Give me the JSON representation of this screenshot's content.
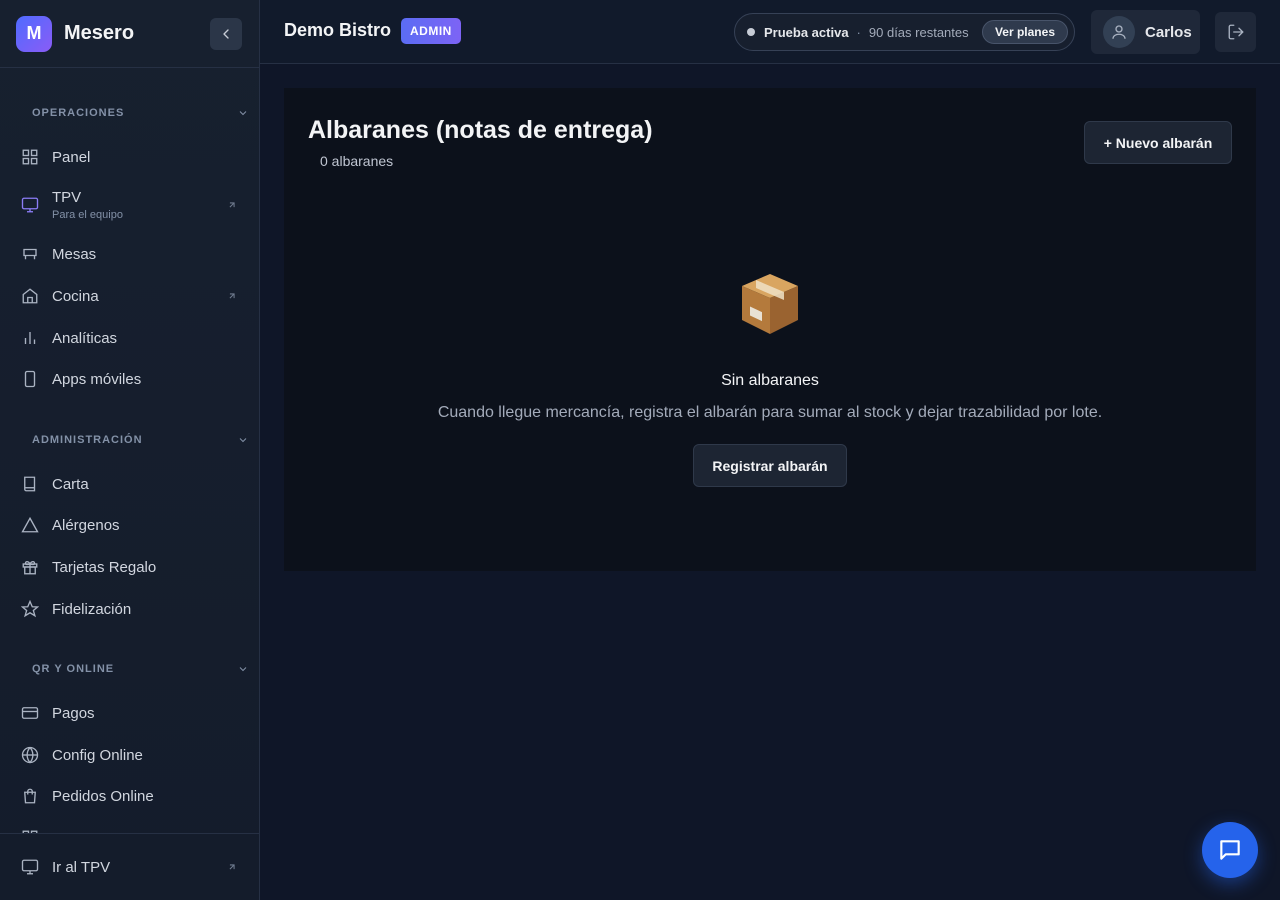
{
  "brand": {
    "logo_letter": "M",
    "name": "Mesero"
  },
  "sidebar": {
    "sections": [
      {
        "title": "OPERACIONES"
      },
      {
        "title": "ADMINISTRACIÓN"
      },
      {
        "title": "QR Y ONLINE"
      }
    ],
    "items": [
      {
        "label": "Panel",
        "icon": "grid-icon"
      },
      {
        "label": "TPV",
        "sublabel": "Para el equipo",
        "icon": "monitor-icon",
        "external": true
      },
      {
        "label": "Mesas",
        "icon": "table-icon"
      },
      {
        "label": "Cocina",
        "icon": "home-icon",
        "external": true
      },
      {
        "label": "Analíticas",
        "icon": "bar-chart-icon"
      },
      {
        "label": "Apps móviles",
        "icon": "smartphone-icon"
      },
      {
        "label": "Carta",
        "icon": "book-icon"
      },
      {
        "label": "Alérgenos",
        "icon": "alert-triangle-icon"
      },
      {
        "label": "Tarjetas Regalo",
        "icon": "gift-icon"
      },
      {
        "label": "Fidelización",
        "icon": "star-icon"
      },
      {
        "label": "Pagos",
        "icon": "credit-card-icon"
      },
      {
        "label": "Config Online",
        "icon": "globe-icon"
      },
      {
        "label": "Pedidos Online",
        "icon": "shopping-bag-icon"
      }
    ],
    "footer_item": {
      "label": "Ir al TPV",
      "icon": "monitor-icon"
    }
  },
  "topbar": {
    "org_name": "Demo Bistro",
    "role_badge": "ADMIN",
    "trial": {
      "label": "Prueba activa",
      "separator": "·",
      "days": "90 días restantes",
      "plans_button": "Ver planes"
    },
    "user_name": "Carlos"
  },
  "main": {
    "title": "Albaranes (notas de entrega)",
    "count": "0 albaranes",
    "new_button": "+ Nuevo albarán",
    "empty": {
      "icon": "package-icon",
      "title": "Sin albaranes",
      "description": "Cuando llegue mercancía, registra el albarán para sumar al stock y dejar trazabilidad por lote.",
      "button": "Registrar albarán"
    }
  },
  "colors": {
    "accent": "#5b6cf4",
    "fab": "#2563eb",
    "background": "#0f1628"
  }
}
